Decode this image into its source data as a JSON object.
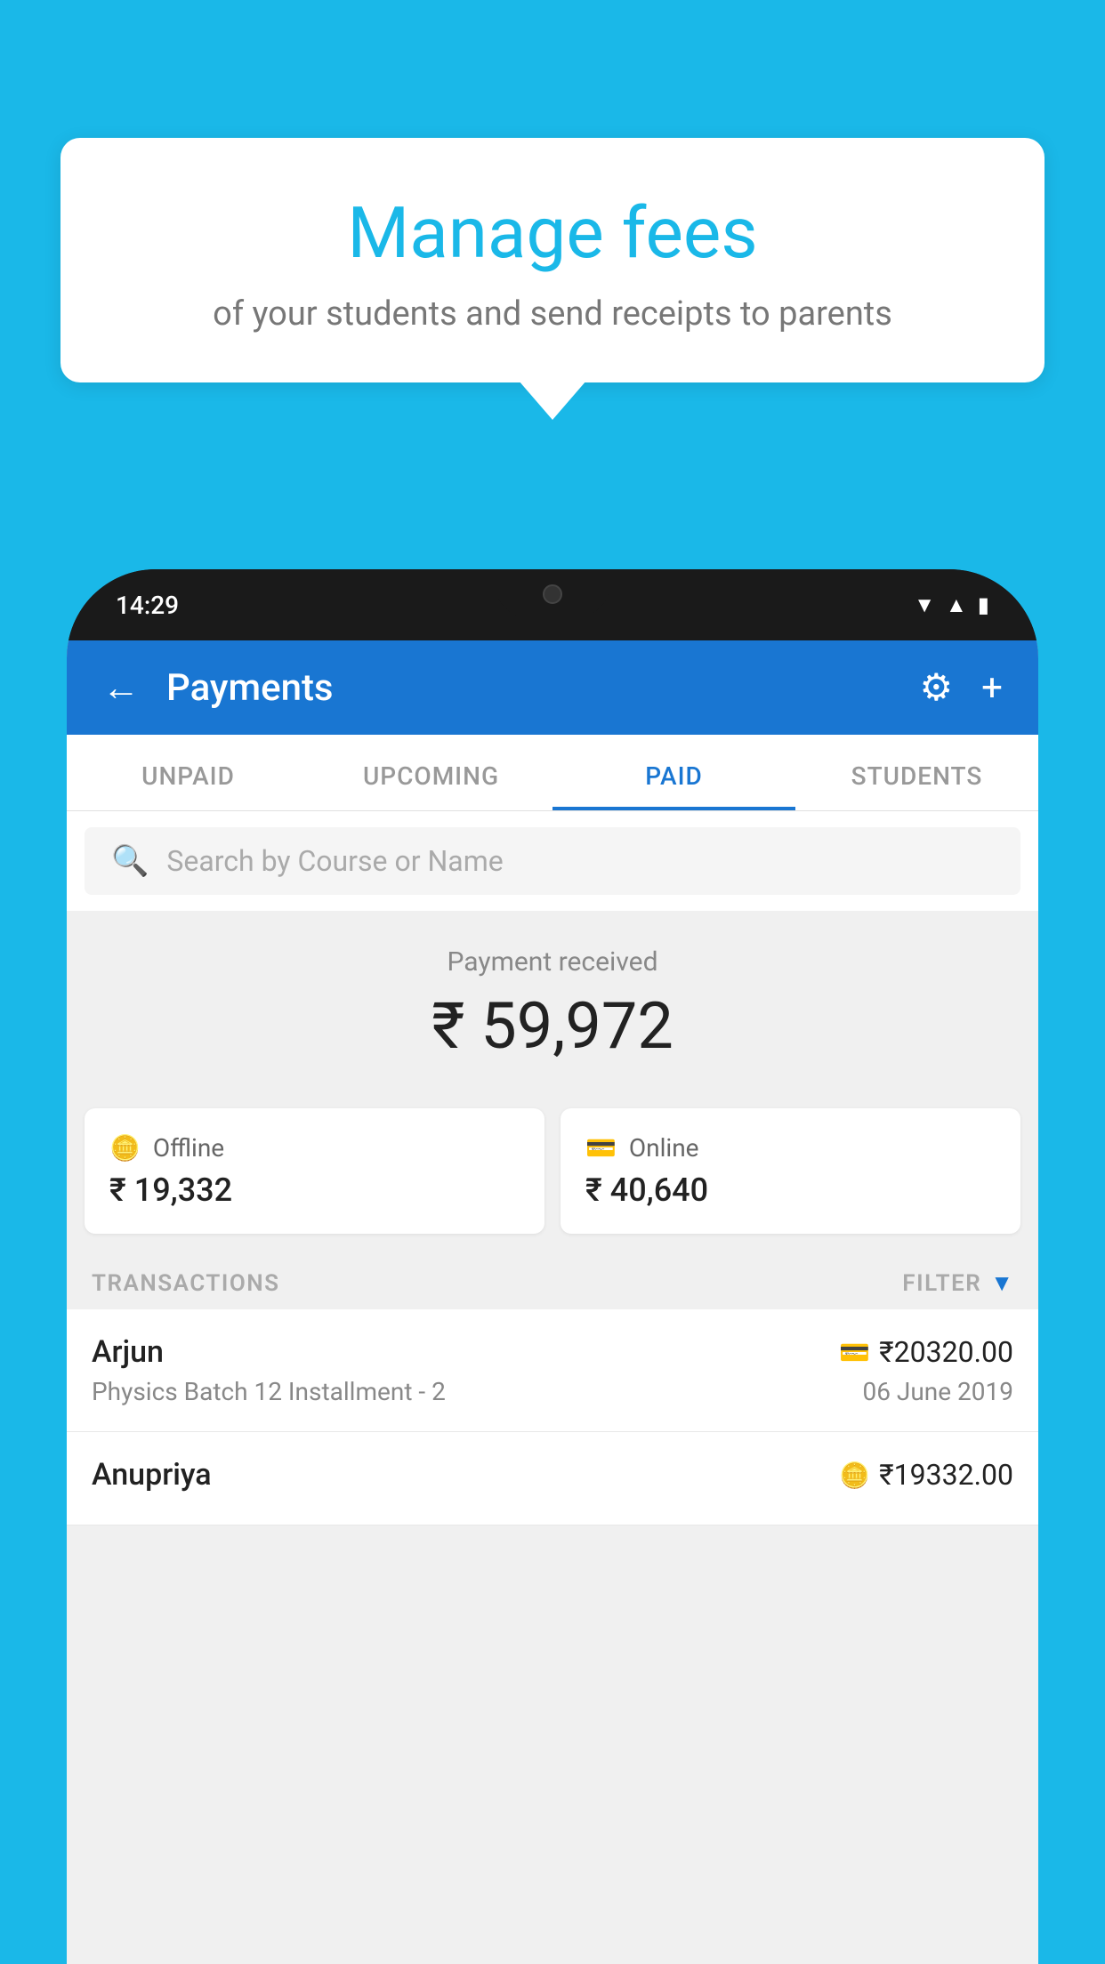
{
  "background_color": "#1ab8e8",
  "speech_bubble": {
    "title": "Manage fees",
    "subtitle": "of your students and send receipts to parents"
  },
  "phone": {
    "time": "14:29",
    "header": {
      "title": "Payments",
      "back_label": "←",
      "gear_label": "⚙",
      "plus_label": "+"
    },
    "tabs": [
      {
        "label": "UNPAID",
        "active": false
      },
      {
        "label": "UPCOMING",
        "active": false
      },
      {
        "label": "PAID",
        "active": true
      },
      {
        "label": "STUDENTS",
        "active": false
      }
    ],
    "search": {
      "placeholder": "Search by Course or Name"
    },
    "payment_received": {
      "label": "Payment received",
      "amount": "₹ 59,972"
    },
    "cards": [
      {
        "type": "Offline",
        "amount": "₹ 19,332",
        "icon": "rupee-card"
      },
      {
        "type": "Online",
        "amount": "₹ 40,640",
        "icon": "credit-card"
      }
    ],
    "transactions_label": "TRANSACTIONS",
    "filter_label": "FILTER",
    "transactions": [
      {
        "name": "Arjun",
        "course": "Physics Batch 12 Installment - 2",
        "amount": "₹20320.00",
        "date": "06 June 2019",
        "payment_type": "online"
      },
      {
        "name": "Anupriya",
        "course": "",
        "amount": "₹19332.00",
        "date": "",
        "payment_type": "offline"
      }
    ]
  }
}
